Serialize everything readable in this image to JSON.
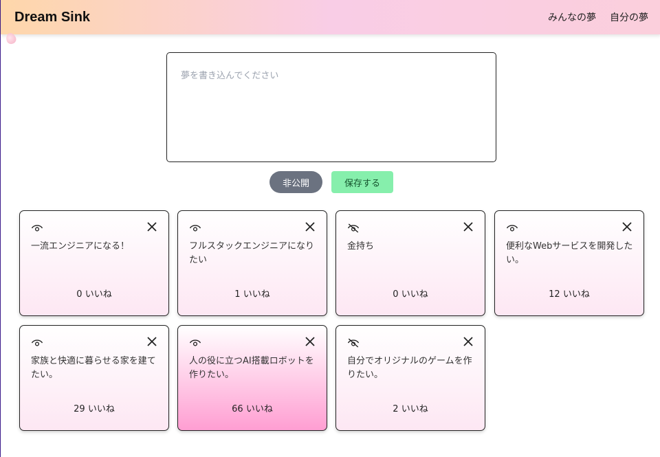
{
  "header": {
    "title": "Dream Sink",
    "nav": [
      "みんなの夢",
      "自分の夢"
    ]
  },
  "composer": {
    "placeholder": "夢を書き込んでください",
    "value": "",
    "private_label": "非公開",
    "save_label": "保存する"
  },
  "colors": {
    "private_button": "#6b7280",
    "save_button": "#86efac",
    "header_gradient": [
      "#fed7aa",
      "#f9cde6",
      "#fbcfdc"
    ]
  },
  "cards": [
    {
      "text": "一流エンジニアになる！",
      "likes": "0 いいね",
      "visible": true,
      "hot": false
    },
    {
      "text": "フルスタックエンジニアになりたい",
      "likes": "1 いいね",
      "visible": true,
      "hot": false
    },
    {
      "text": "金持ち",
      "likes": "0 いいね",
      "visible": false,
      "hot": false
    },
    {
      "text": "便利なWebサービスを開発したい。",
      "likes": "12 いいね",
      "visible": true,
      "hot": false
    },
    {
      "text": "家族と快適に暮らせる家を建てたい。",
      "likes": "29 いいね",
      "visible": true,
      "hot": false
    },
    {
      "text": "人の役に立つAI搭載ロボットを作りたい。",
      "likes": "66 いいね",
      "visible": true,
      "hot": true
    },
    {
      "text": "自分でオリジナルのゲームを作りたい。",
      "likes": "2 いいね",
      "visible": false,
      "hot": false
    }
  ]
}
